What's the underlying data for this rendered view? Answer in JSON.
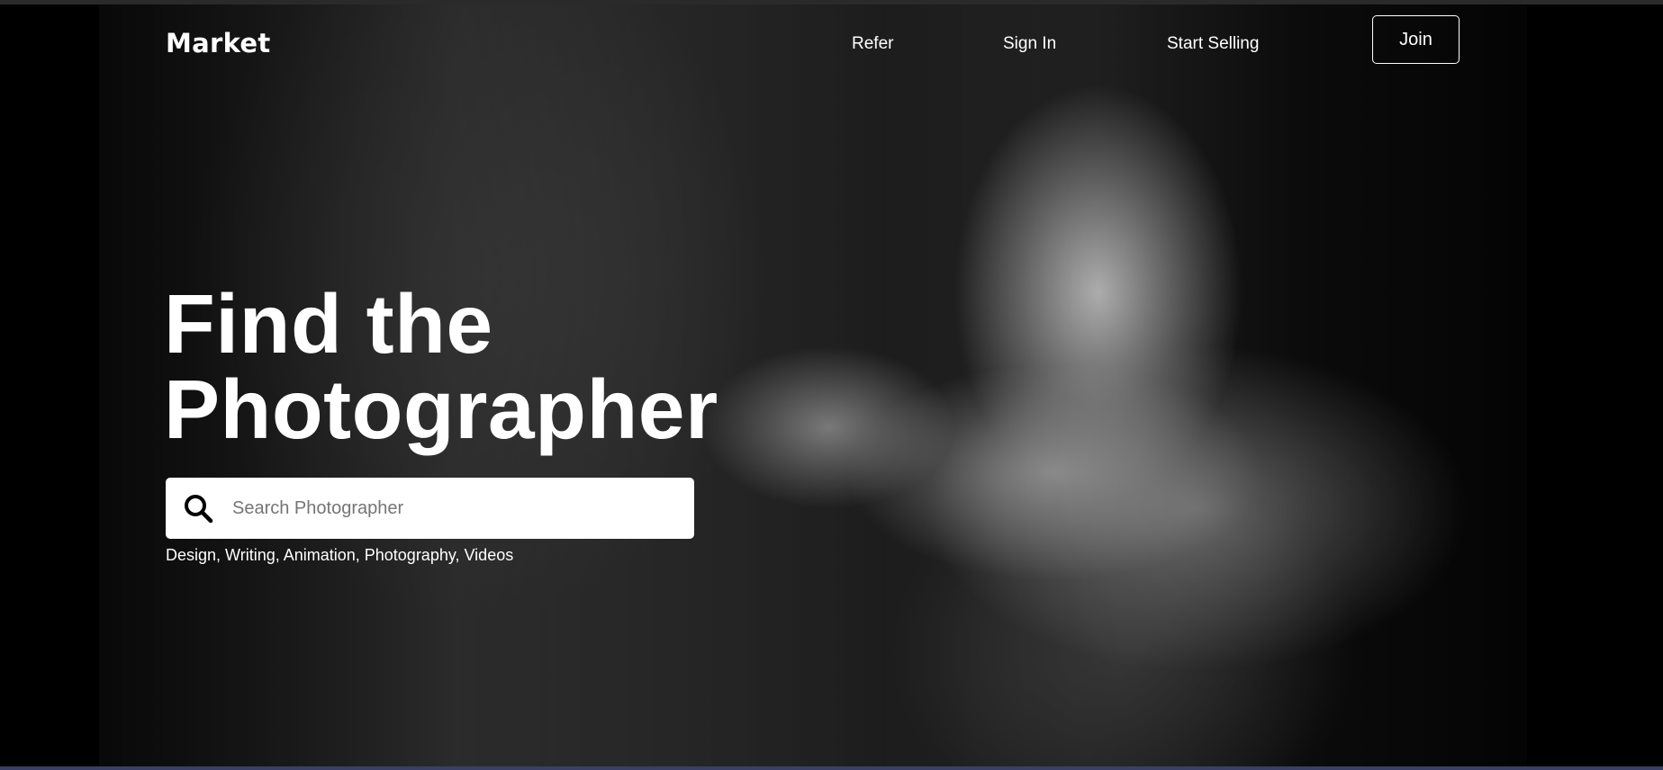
{
  "header": {
    "logo": "Market",
    "nav": {
      "refer": "Refer",
      "sign_in": "Sign In",
      "start_selling": "Start Selling",
      "join": "Join"
    }
  },
  "hero": {
    "headline_line1": "Find the",
    "headline_line2": "Photographer",
    "search": {
      "placeholder": "Search Photographer",
      "value": "",
      "icon": "search-icon"
    },
    "categories": "Design, Writing, Animation, Photography, Videos",
    "background_image": "black-and-white hand holding an Olympus PEN camera"
  },
  "colors": {
    "background": "#000000",
    "text": "#ffffff",
    "search_bg": "#ffffff",
    "placeholder": "#757575"
  }
}
